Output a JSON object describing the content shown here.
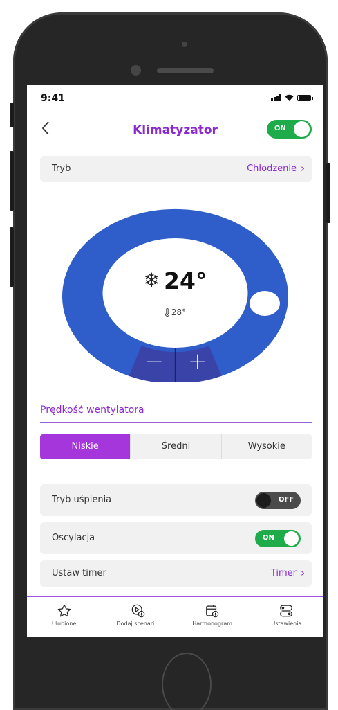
{
  "status_bar": {
    "time": "9:41"
  },
  "header": {
    "back_icon": "chevron-left-icon",
    "title": "Klimatyzator",
    "power_toggle": {
      "label": "ON",
      "state": true
    }
  },
  "mode_row": {
    "label": "Tryb",
    "value": "Chłodzenie"
  },
  "dial": {
    "mode_icon": "snowflake-icon",
    "target_temp": "24°",
    "current_temp_icon": "thermometer-icon",
    "current_temp": "28°",
    "minus_label": "−",
    "plus_label": "+",
    "colors": {
      "ring": "#2f5ecb",
      "controls": "#3a44a8"
    }
  },
  "fan_speed": {
    "title": "Prędkość wentylatora",
    "options": [
      "Niskie",
      "Średni",
      "Wysokie"
    ],
    "selected": "Niskie"
  },
  "settings": {
    "sleep": {
      "label": "Tryb uśpienia",
      "toggle_label": "OFF",
      "state": false
    },
    "oscillation": {
      "label": "Oscylacja",
      "toggle_label": "ON",
      "state": true
    },
    "timer": {
      "label": "Ustaw timer",
      "value": "Timer"
    }
  },
  "tabbar": {
    "items": [
      {
        "label": "Ulubione",
        "icon": "star-icon"
      },
      {
        "label": "Dodaj scenari…",
        "icon": "add-scene-icon"
      },
      {
        "label": "Harmonogram",
        "icon": "calendar-add-icon"
      },
      {
        "label": "Ustawienia",
        "icon": "toggles-icon"
      }
    ]
  },
  "colors": {
    "accent": "#8a2ad0",
    "toggle_on": "#1eab4a",
    "segment_active": "#a436db"
  }
}
